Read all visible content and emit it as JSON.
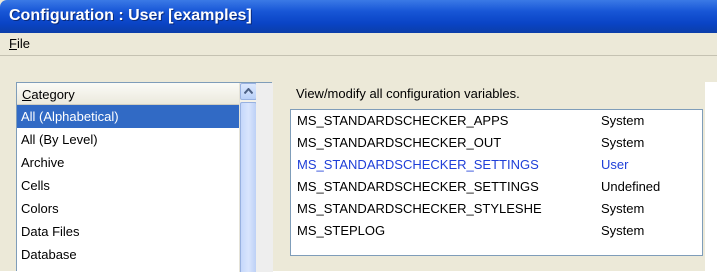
{
  "window": {
    "title": "Configuration : User [examples]"
  },
  "menu": {
    "file_label": "File",
    "file_mnemonic": "F",
    "file_rest": "ile"
  },
  "category": {
    "header": "Category",
    "items": [
      "All (Alphabetical)",
      "All (By Level)",
      "Archive",
      "Cells",
      "Colors",
      "Data Files",
      "Database"
    ],
    "selected_index": 0
  },
  "panel": {
    "description": "View/modify all configuration variables.",
    "variables": [
      {
        "name": "MS_STANDARDSCHECKER_APPS",
        "level": "System"
      },
      {
        "name": "MS_STANDARDSCHECKER_OUT",
        "level": "System"
      },
      {
        "name": "MS_STANDARDSCHECKER_SETTINGS",
        "level": "User"
      },
      {
        "name": "MS_STANDARDSCHECKER_SETTINGS",
        "level": "Undefined"
      },
      {
        "name": "MS_STANDARDSCHECKER_STYLESHE",
        "level": "System"
      },
      {
        "name": "MS_STEPLOG",
        "level": "System"
      }
    ]
  },
  "colors": {
    "selection": "#316ac5",
    "titlebar": "#0a44c6",
    "user_level_text": "#1f3fd8"
  }
}
